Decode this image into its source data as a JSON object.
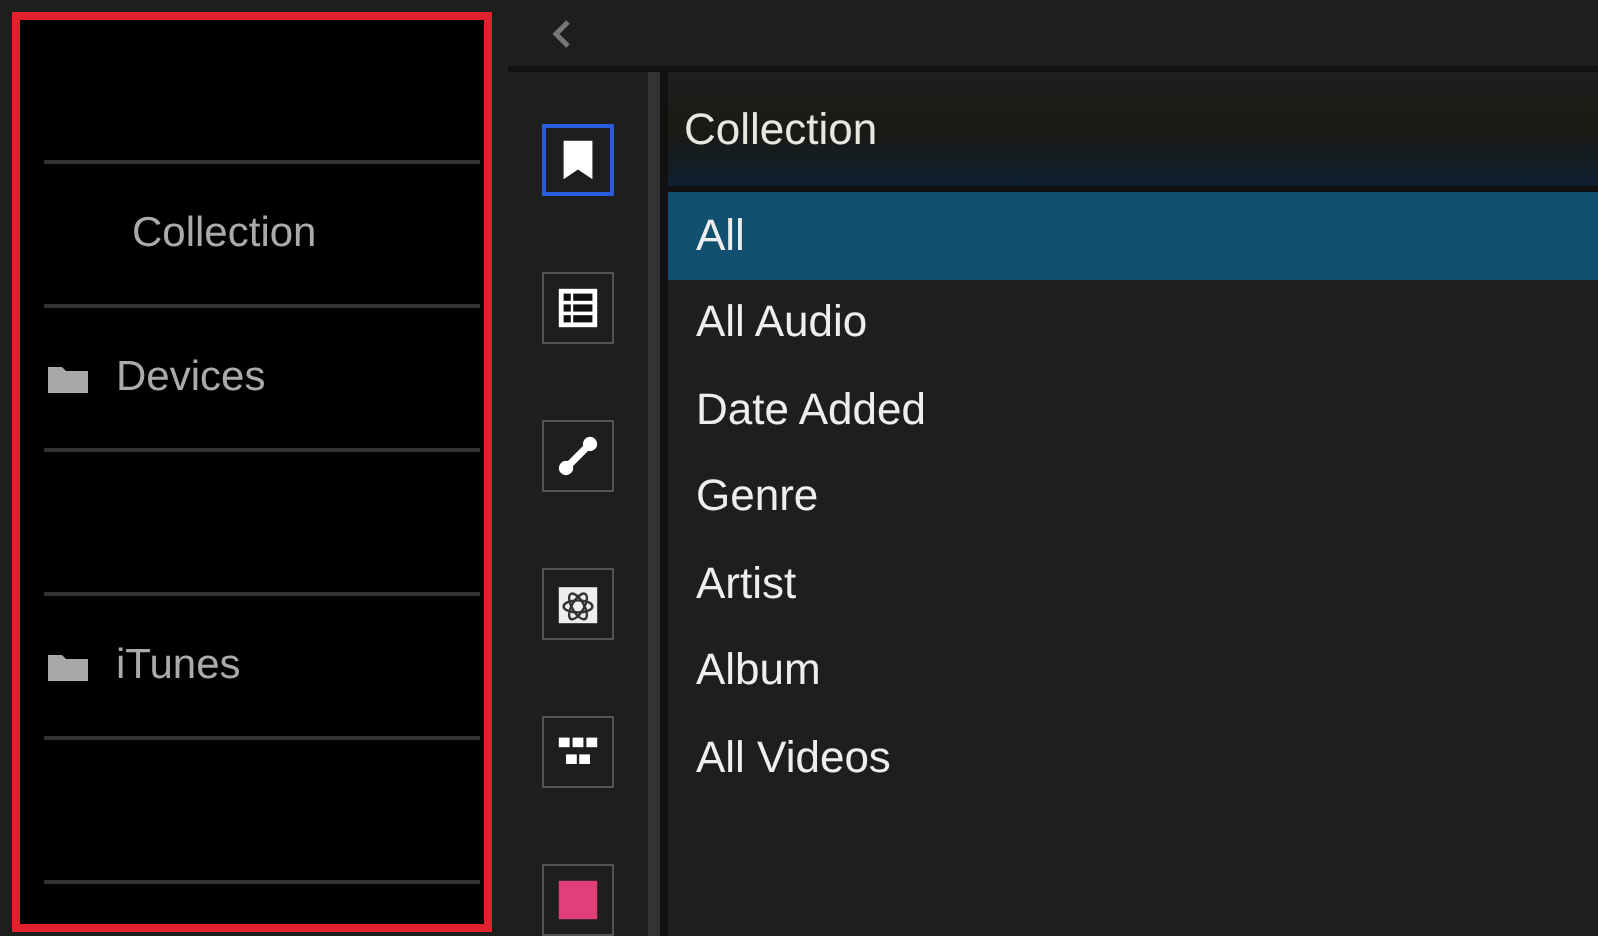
{
  "left_panel": {
    "rows": [
      {
        "kind": "empty"
      },
      {
        "kind": "heading",
        "label": "Collection"
      },
      {
        "kind": "folder",
        "label": "Devices"
      },
      {
        "kind": "empty"
      },
      {
        "kind": "folder",
        "label": "iTunes"
      },
      {
        "kind": "empty"
      },
      {
        "kind": "empty"
      }
    ]
  },
  "tool_strip": {
    "tools": [
      {
        "kind": "bookmark",
        "selected": true
      },
      {
        "kind": "list",
        "selected": false
      },
      {
        "kind": "link",
        "selected": false
      },
      {
        "kind": "atom",
        "selected": false
      },
      {
        "kind": "grid",
        "selected": false
      },
      {
        "kind": "tile",
        "selected": false
      }
    ]
  },
  "collection": {
    "title": "Collection",
    "items": [
      {
        "label": "All",
        "selected": true
      },
      {
        "label": "All Audio",
        "selected": false
      },
      {
        "label": "Date Added",
        "selected": false
      },
      {
        "label": "Genre",
        "selected": false
      },
      {
        "label": "Artist",
        "selected": false
      },
      {
        "label": "Album",
        "selected": false
      },
      {
        "label": "All Videos",
        "selected": false
      }
    ]
  }
}
